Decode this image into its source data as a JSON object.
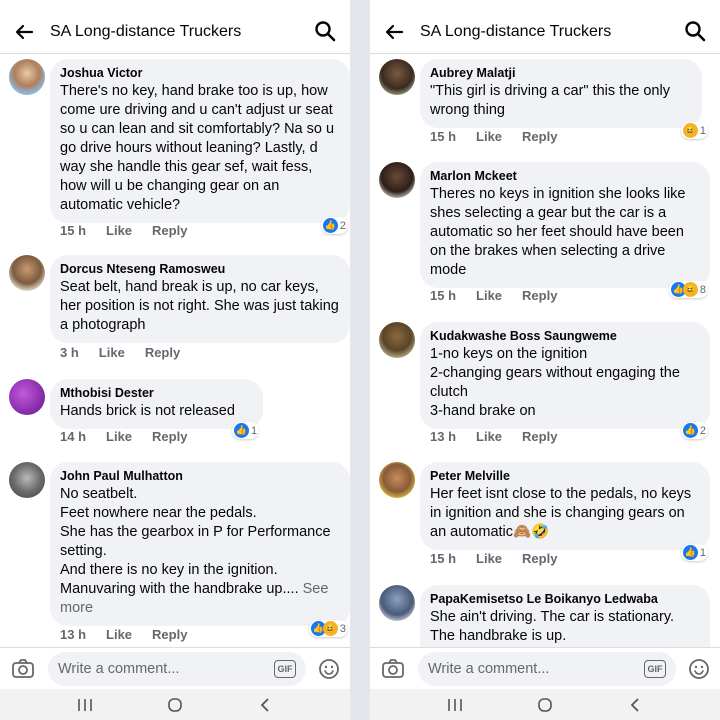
{
  "colors": {
    "accent": "#1877f2",
    "muted": "#65676b",
    "bubble": "#f0f2f5",
    "haha": "#f7b125"
  },
  "left": {
    "header": {
      "title": "SA Long-distance Truckers"
    },
    "composer": {
      "placeholder": "Write a comment...",
      "gif_label": "GIF"
    },
    "comments": [
      {
        "author": "Joshua Victor",
        "text": "There's no key, hand brake too is up, how come ure driving and u can't adjust ur seat so u can lean and sit comfortably? Na so u go drive hours without leaning? Lastly, d way she handle this gear sef, wait fess, how will u be changing gear on an automatic vehicle?",
        "time": "15 h",
        "like": "Like",
        "reply": "Reply",
        "reactions": [
          "like-icon"
        ],
        "count": "2"
      },
      {
        "author": "Dorcus Nteseng Ramosweu",
        "text": "Seat belt, hand break is up, no car keys, her position is not right. She was just taking a photograph",
        "time": "3 h",
        "like": "Like",
        "reply": "Reply"
      },
      {
        "author": "Mthobisi Dester",
        "text": "Hands brick is not released",
        "time": "14 h",
        "like": "Like",
        "reply": "Reply",
        "reactions": [
          "like-icon"
        ],
        "count": "1"
      },
      {
        "author": "John Paul Mulhatton",
        "text": "No seatbelt.\nFeet nowhere near the pedals.\nShe has the gearbox in P for Performance setting.\nAnd there is no key in the ignition.\nManuvaring with the handbrake up....",
        "see_more": "See more",
        "time": "13 h",
        "like": "Like",
        "reply": "Reply",
        "reactions": [
          "like-icon",
          "haha-icon"
        ],
        "count": "3"
      }
    ]
  },
  "right": {
    "header": {
      "title": "SA Long-distance Truckers"
    },
    "composer": {
      "placeholder": "Write a comment...",
      "gif_label": "GIF"
    },
    "comments": [
      {
        "author": "Aubrey Malatji",
        "text": "\"This girl is driving a car\" this the only wrong thing",
        "time": "15 h",
        "like": "Like",
        "reply": "Reply",
        "reactions": [
          "haha-icon"
        ],
        "count": "1"
      },
      {
        "author": "Marlon Mckeet",
        "text": "Theres no keys in ignition she  looks like shes selecting a gear but the car is a automatic so her feet should have been on the brakes when selecting a drive mode",
        "time": "15 h",
        "like": "Like",
        "reply": "Reply",
        "reactions": [
          "like-icon",
          "haha-icon"
        ],
        "count": "8"
      },
      {
        "author": "Kudakwashe Boss Saungweme",
        "text": "1-no keys on the ignition\n2-changing gears without engaging the clutch\n3-hand brake on",
        "time": "13 h",
        "like": "Like",
        "reply": "Reply",
        "reactions": [
          "like-icon"
        ],
        "count": "2"
      },
      {
        "author": "Peter Melville",
        "text": "Her feet isnt close to the pedals, no keys in ignition and she is changing gears on an automatic🙈🤣",
        "time": "15 h",
        "like": "Like",
        "reply": "Reply",
        "reactions": [
          "like-icon"
        ],
        "count": "1"
      },
      {
        "author": "PapaKemisetso Le Boikanyo Ledwaba",
        "text": "She ain't driving. The car is stationary. The handbrake is up."
      }
    ]
  }
}
